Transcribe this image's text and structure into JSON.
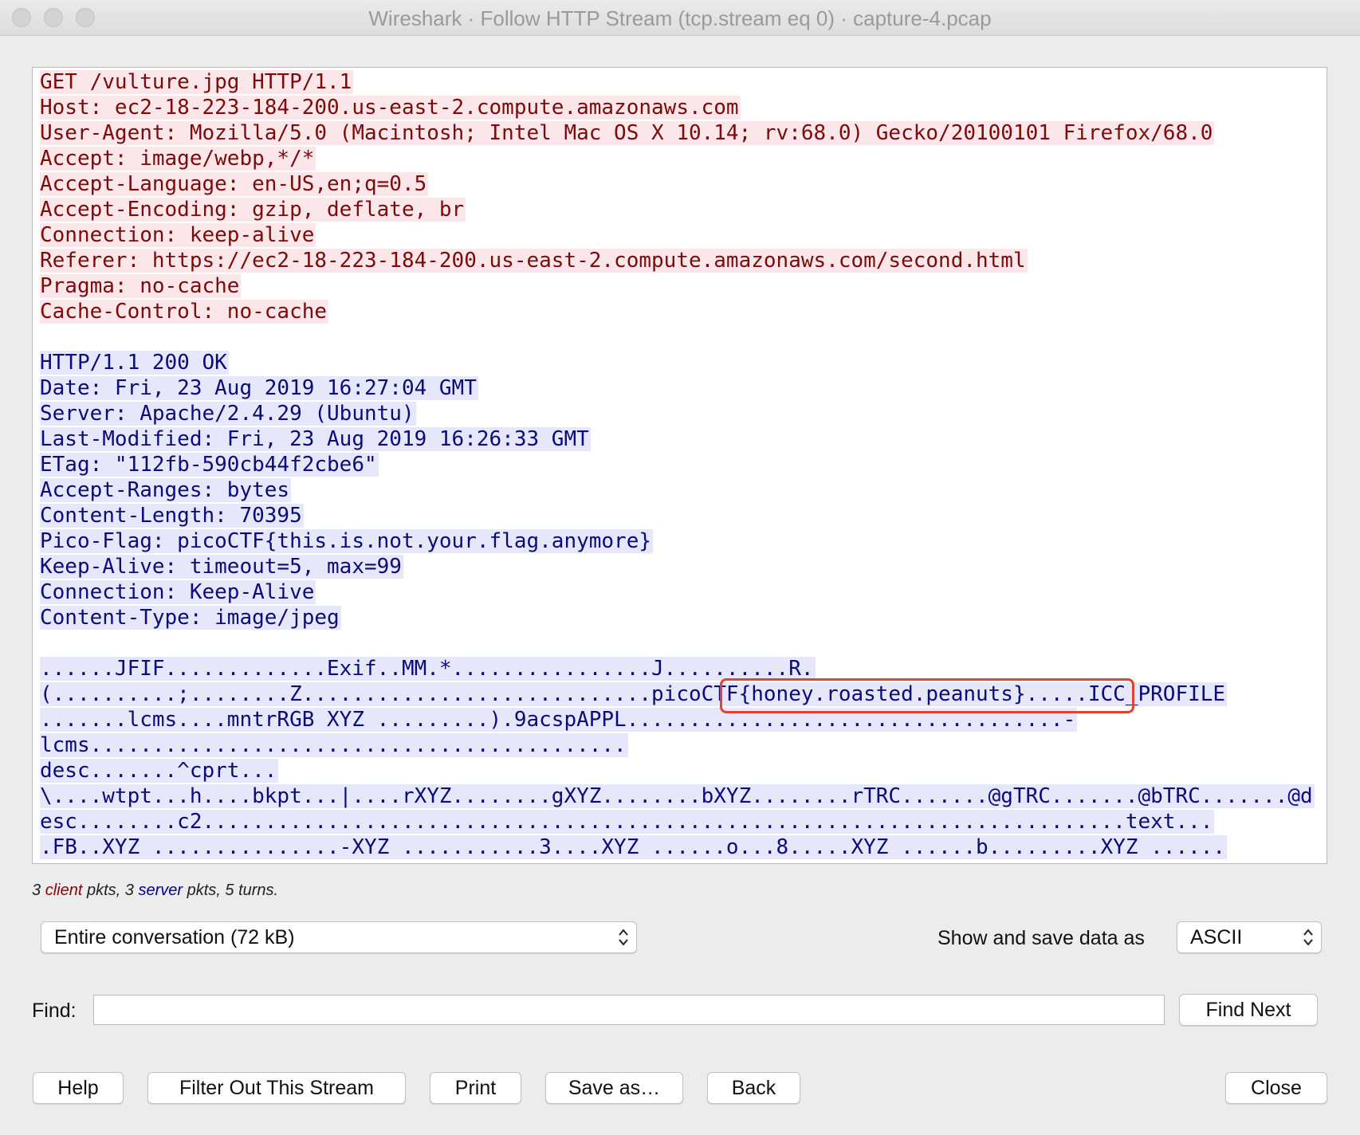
{
  "window": {
    "title": "Wireshark · Follow HTTP Stream (tcp.stream eq 0) · capture-4.pcap"
  },
  "stream": {
    "client_lines": [
      "GET /vulture.jpg HTTP/1.1",
      "Host: ec2-18-223-184-200.us-east-2.compute.amazonaws.com",
      "User-Agent: Mozilla/5.0 (Macintosh; Intel Mac OS X 10.14; rv:68.0) Gecko/20100101 Firefox/68.0",
      "Accept: image/webp,*/*",
      "Accept-Language: en-US,en;q=0.5",
      "Accept-Encoding: gzip, deflate, br",
      "Connection: keep-alive",
      "Referer: https://ec2-18-223-184-200.us-east-2.compute.amazonaws.com/second.html",
      "Pragma: no-cache",
      "Cache-Control: no-cache"
    ],
    "server_lines": [
      "HTTP/1.1 200 OK",
      "Date: Fri, 23 Aug 2019 16:27:04 GMT",
      "Server: Apache/2.4.29 (Ubuntu)",
      "Last-Modified: Fri, 23 Aug 2019 16:26:33 GMT",
      "ETag: \"112fb-590cb44f2cbe6\"",
      "Accept-Ranges: bytes",
      "Content-Length: 70395",
      "Pico-Flag: picoCTF{this.is.not.your.flag.anymore}",
      "Keep-Alive: timeout=5, max=99",
      "Connection: Keep-Alive",
      "Content-Type: image/jpeg"
    ],
    "binary_lines": [
      "......JFIF.............Exif..MM.*................J..........R.",
      "(..........;........Z............................picoCTF{honey.roasted.peanuts}.....ICC_PROFILE",
      ".......lcms....mntrRGB XYZ .........).9acspAPPL...................................-",
      "lcms...........................................",
      "desc.......^cprt...",
      "\\....wtpt...h....bkpt...|....rXYZ........gXYZ........bXYZ........rTRC.......@gTRC.......@bTRC.......@d",
      "esc........c2..........................................................................text...",
      ".FB..XYZ ...............-XYZ ...........3....XYZ ......o...8.....XYZ ......b.........XYZ ......"
    ],
    "highlighted_flag": "picoCTF{honey.roasted.peanuts}"
  },
  "stats": {
    "count_client": "3",
    "client_word": "client",
    "pkts1": "pkts,",
    "count_server": "3",
    "server_word": "server",
    "pkts2": "pkts, 5 turns."
  },
  "controls": {
    "conversation_select": "Entire conversation (72 kB)",
    "show_save_label": "Show and save data as",
    "format_select": "ASCII",
    "find_label": "Find:",
    "find_value": "",
    "find_next": "Find Next"
  },
  "buttons": {
    "help": "Help",
    "filter_out": "Filter Out This Stream",
    "print": "Print",
    "save_as": "Save as…",
    "back": "Back",
    "close": "Close"
  },
  "colors": {
    "client_bg": "#fbe7e9",
    "client_fg": "#7d0a0a",
    "server_bg": "#e7e7fb",
    "server_fg": "#0b0b7a",
    "highlight_box": "#e5412f"
  }
}
